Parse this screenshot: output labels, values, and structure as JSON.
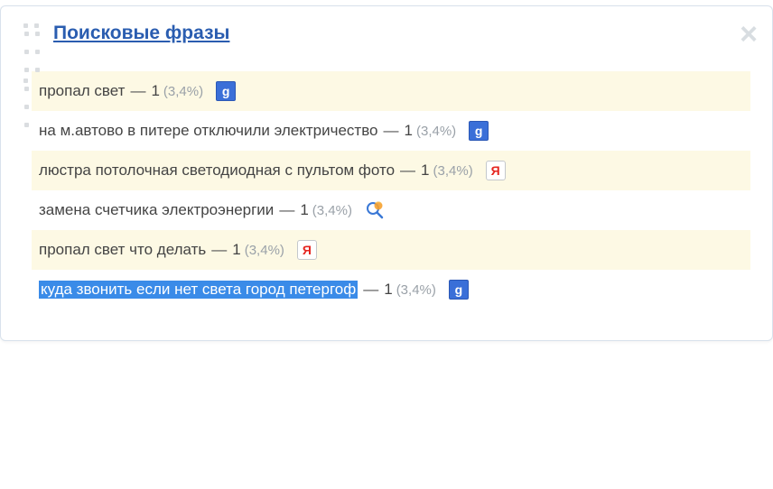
{
  "header": {
    "title": "Поисковые фразы"
  },
  "rows": [
    {
      "phrase": "пропал свет",
      "count": 1,
      "percent": "(3,4%)",
      "source": "google",
      "highlighted": false
    },
    {
      "phrase": "на м.автово в питере отключили электричество",
      "count": 1,
      "percent": "(3,4%)",
      "source": "google",
      "highlighted": false
    },
    {
      "phrase": "люстра потолочная светодиодная с пультом фото",
      "count": 1,
      "percent": "(3,4%)",
      "source": "yandex",
      "highlighted": false
    },
    {
      "phrase": "замена счетчика электроэнергии",
      "count": 1,
      "percent": "(3,4%)",
      "source": "search",
      "highlighted": false
    },
    {
      "phrase": "пропал свет что делать",
      "count": 1,
      "percent": "(3,4%)",
      "source": "yandex",
      "highlighted": false
    },
    {
      "phrase": "куда звонить если нет света город петергоф",
      "count": 1,
      "percent": "(3,4%)",
      "source": "google",
      "highlighted": true
    }
  ]
}
